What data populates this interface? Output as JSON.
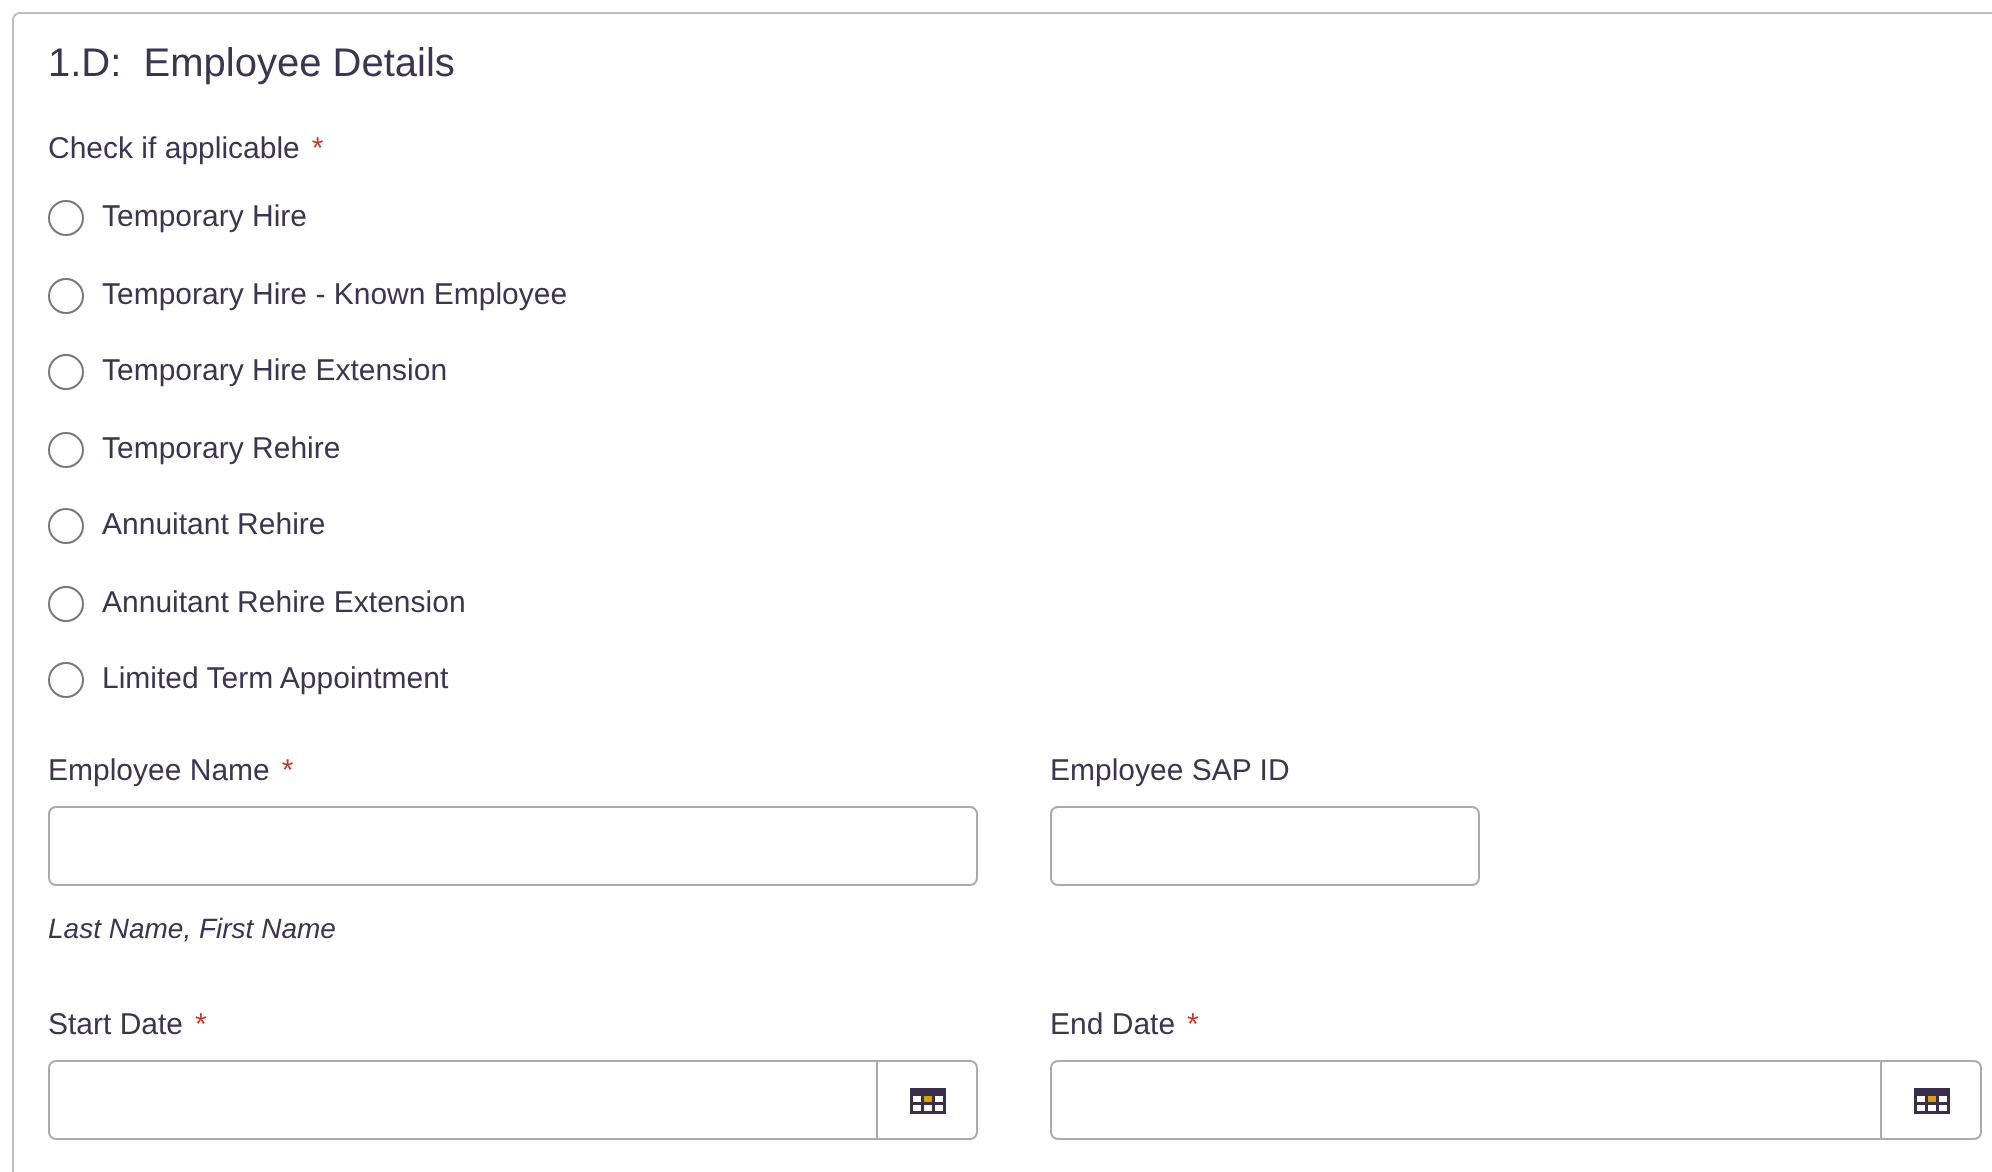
{
  "section": {
    "title": "1.D:  Employee Details"
  },
  "applicable": {
    "label": "Check if applicable",
    "required_mark": "*",
    "options": [
      {
        "label": "Temporary Hire",
        "selected": false
      },
      {
        "label": "Temporary Hire - Known Employee",
        "selected": false
      },
      {
        "label": "Temporary Hire Extension",
        "selected": false
      },
      {
        "label": "Temporary Rehire",
        "selected": false
      },
      {
        "label": "Annuitant Rehire",
        "selected": false
      },
      {
        "label": "Annuitant Rehire Extension",
        "selected": false
      },
      {
        "label": "Limited Term Appointment",
        "selected": false
      }
    ]
  },
  "rows": [
    {
      "fields": [
        {
          "kind": "text",
          "label": "Employee Name",
          "required_mark": "*",
          "hint": "Last Name, First Name"
        },
        {
          "kind": "text",
          "label": "Employee SAP ID"
        }
      ]
    },
    {
      "fields": [
        {
          "kind": "date",
          "label": "Start Date",
          "required_mark": "*"
        },
        {
          "kind": "date",
          "label": "End Date",
          "required_mark": "*"
        }
      ]
    }
  ]
}
